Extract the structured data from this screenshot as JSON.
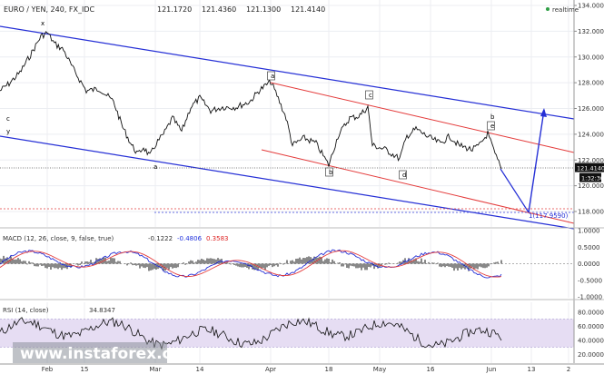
{
  "header": {
    "title": "EURO / YEN, 240, FX_IDC",
    "ohlc": [
      "121.1720",
      "121.4360",
      "121.1300",
      "121.4140"
    ],
    "realtime": "realtime"
  },
  "price_pane": {
    "y_ticks": [
      "134.0000",
      "132.0000",
      "130.0000",
      "128.0000",
      "126.0000",
      "124.0000",
      "122.0000",
      "120.0000",
      "118.0000"
    ],
    "last_price": "121.4140",
    "countdown": "1:32:30",
    "target_label": "1(117.9590)",
    "wave_labels": [
      "x",
      "c",
      "y",
      "a",
      "a",
      "b",
      "c",
      "d",
      "b",
      "e"
    ]
  },
  "macd_pane": {
    "label": "MACD (12, 26, close, 9, false, true)",
    "values": [
      "-0.1222",
      "-0.4806",
      "0.3583"
    ],
    "y_ticks": [
      "1.0000",
      "0.5000",
      "0.0000",
      "-0.5000",
      "-1.0000"
    ]
  },
  "rsi_pane": {
    "label": "RSI (14, close)",
    "value": "34.8347",
    "y_ticks": [
      "80.0000",
      "60.0000",
      "40.0000",
      "20.0000"
    ]
  },
  "x_axis": {
    "labels": [
      "Feb",
      "15",
      "Mar",
      "14",
      "Apr",
      "18",
      "May",
      "16",
      "Jun",
      "13",
      "2"
    ]
  },
  "watermark": "www.instaforex.com",
  "chart_data": {
    "type": "line",
    "title": "EURO / YEN, 240, FX_IDC",
    "x": [
      "Feb",
      "15",
      "Mar",
      "14",
      "Apr",
      "18",
      "May",
      "16",
      "Jun"
    ],
    "series": [
      {
        "values": [
          126.5,
          128.2,
          125.0,
          124.2,
          127.8,
          125.8,
          122.6,
          124.5,
          122.9,
          121.4
        ]
      }
    ],
    "ylim": [
      117.0,
      134.5
    ],
    "grid": true,
    "annotations": [
      "1(117.9590)"
    ]
  }
}
